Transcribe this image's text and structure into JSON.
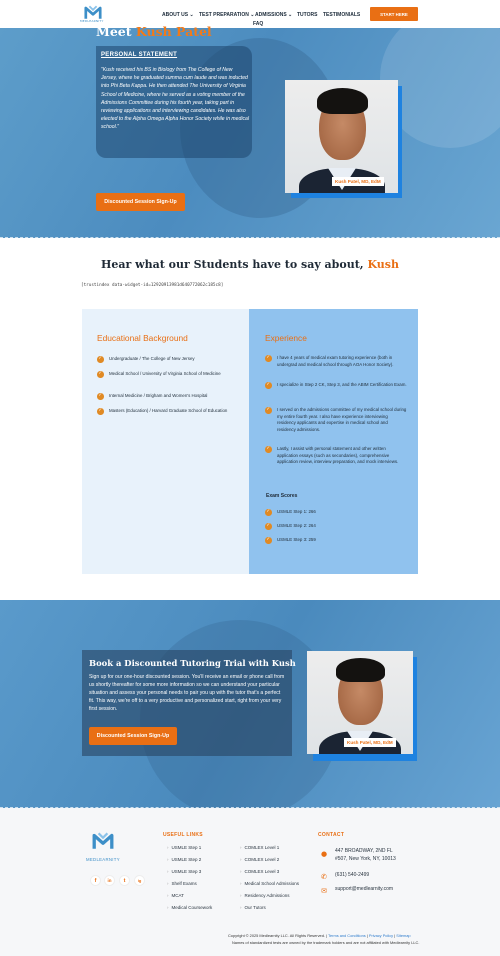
{
  "brand": {
    "logo_text": "MEDLEARNITY",
    "footer_logo_text": "MEDLEARNITY"
  },
  "nav": {
    "items": [
      "ABOUT US",
      "TEST PREPARATION",
      "ADMISSIONS",
      "TUTORS",
      "TESTIMONIALS",
      "FAQ"
    ],
    "start_label": "START HERE"
  },
  "hero": {
    "meet": "Meet",
    "name": "Kush Patel",
    "statement_title": "PERSONAL STATEMENT",
    "statement": "\"Kush received his BS in Biology from The College of New Jersey, where he graduated summa cum laude and was inducted into Phi Beta Kappa. He then attended The University of Virginia School of Medicine, where he served as a voting member of the Admissions Committee during his fourth year, taking part in reviewing applications and interviewing candidates. He was also elected to the Alpha Omega Alpha Honor Society while in medical school.\"",
    "cta_label": "Discounted Session Sign-Up",
    "photo_caption": "Kush Patel, MD, EdM"
  },
  "testimonials": {
    "title": "Hear what our Students have to say about,",
    "name": "Kush",
    "widget_text": "[trustindex data-widget-id=12920913981d640772062c185c8]"
  },
  "education": {
    "heading": "Educational Background",
    "items": [
      "Undergraduate / The College of New Jersey",
      "Medical School / University of Virginia School of Medicine",
      "Internal Medicine / Brigham and Women's Hospital",
      "Masters (Education) / Harvard Graduate School of Education"
    ]
  },
  "experience": {
    "heading": "Experience",
    "items": [
      "I have 4 years of medical exam tutoring experience (both in undergrad and medical school through AOA Honor Society).",
      "I specialize in Step 2 CK, Step 3, and the ABIM Certification Exam.",
      "I served on the admissions committee of my medical school during my entire fourth year. I also have experience interviewing residency applicants and expertise in medical school and residency admissions.",
      "Lastly, I assist with personal statement and other written application essays (such as secondaries), comprehensive application review, interview preparation, and mock interviews."
    ],
    "exam_heading": "Exam Scores",
    "scores": [
      "USMLE Step 1: 266",
      "USMLE Step 2: 264",
      "USMLE Step 3: 259"
    ]
  },
  "cta": {
    "title": "Book a Discounted Tutoring Trial with Kush",
    "body": "Sign up for our one-hour discounted session. You'll receive an email or phone call from us shortly thereafter for some more information so we can understand your particular situation and assess your personal needs to pair you up with the tutor that's a perfect fit. This way, we're off to a very productive and personalized start, right from your very first session.",
    "button_label": "Discounted Session Sign-Up",
    "photo_caption": "Kush Patel, MD, EdM"
  },
  "footer": {
    "social": [
      "f",
      "in",
      "t",
      "ig"
    ],
    "useful_links_heading": "USEFUL LINKS",
    "links_col1": [
      "USMLE Step 1",
      "USMLE Step 2",
      "USMLE Step 3",
      "Shelf Exams",
      "MCAT",
      "Medical Coursework"
    ],
    "links_col2": [
      "COMLEX Level 1",
      "COMLEX Level 2",
      "COMLEX Level 3",
      "Medical School Admissions",
      "Residency Admissions",
      "Our Tutors"
    ],
    "contact_heading": "CONTACT",
    "address_line1": "447 BROADWAY, 2ND FL",
    "address_line2": "#507, New York, NY, 10013",
    "phone": "(631) 540-2499",
    "email": "support@medlearnity.com",
    "copyright": "Copyright © 2025 Medlearnity LLC. All Rights Reserved. |",
    "terms": "Terms and Conditions",
    "privacy": "Privacy Policy",
    "sitemap": "Sitemap",
    "trademark": "Names of standardized tests are owned by the trademark holders and are not affiliated with Medlearnity LLC."
  },
  "colors": {
    "accent": "#e96f14",
    "brand_blue": "#3d8fc8",
    "panel_blue": "#90c2ee",
    "panel_light": "#e8f2fb"
  }
}
